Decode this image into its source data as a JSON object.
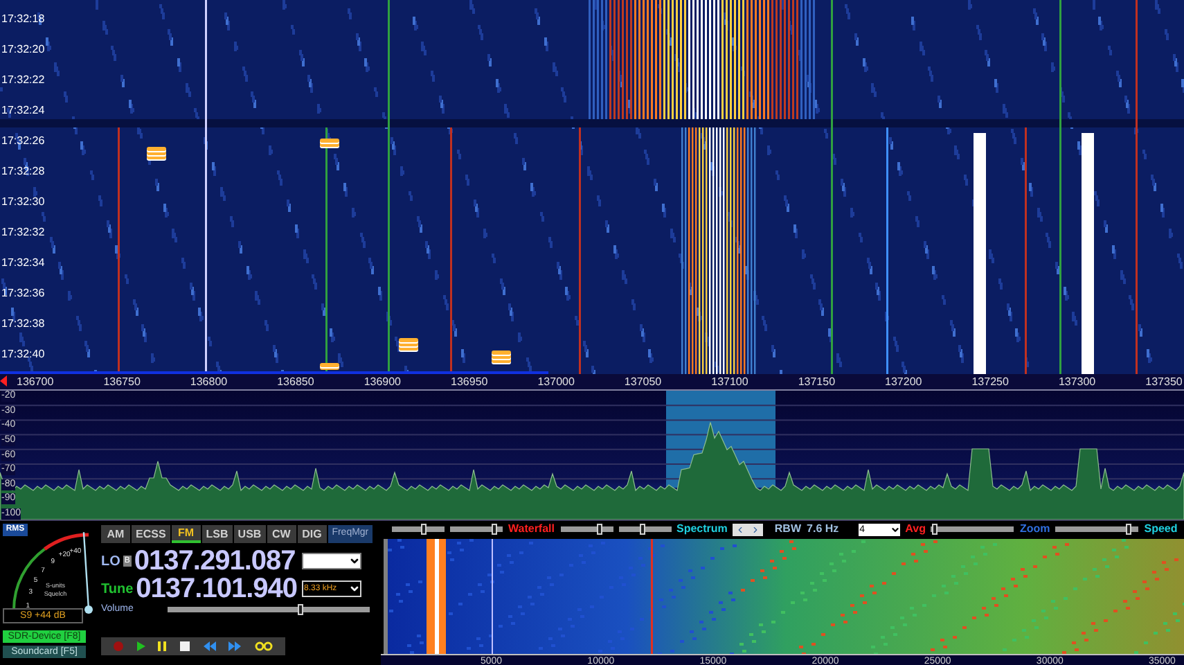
{
  "waterfall": {
    "time_labels": [
      "17:32:18",
      "17:32:20",
      "17:32:22",
      "17:32:24",
      "17:32:26",
      "17:32:28",
      "17:32:30",
      "17:32:32",
      "17:32:34",
      "17:32:36",
      "17:32:38",
      "17:32:40"
    ]
  },
  "frequency_axis": {
    "labels": [
      "136700",
      "136750",
      "136800",
      "136850",
      "136900",
      "136950",
      "137000",
      "137050",
      "137100",
      "137150",
      "137200",
      "137250",
      "137300",
      "137350"
    ]
  },
  "spectrum": {
    "db_labels": [
      "-20",
      "-30",
      "-40",
      "-50",
      "-60",
      "-70",
      "-80",
      "-90",
      "-100"
    ]
  },
  "smeter": {
    "mode_badge": "RMS",
    "scale_labels": [
      "1",
      "3",
      "5",
      "7",
      "9",
      "+20",
      "+40"
    ],
    "units_label": "S-units",
    "squelch_label": "Squelch",
    "level": 0.96,
    "reading": "S9 +44 dB"
  },
  "device_buttons": [
    {
      "label": "SDR-Device [F8]",
      "selected": true
    },
    {
      "label": "Soundcard [F5]",
      "selected": false
    }
  ],
  "modes": [
    {
      "label": "AM",
      "selected": false
    },
    {
      "label": "ECSS",
      "selected": false
    },
    {
      "label": "FM",
      "selected": true
    },
    {
      "label": "LSB",
      "selected": false
    },
    {
      "label": "USB",
      "selected": false
    },
    {
      "label": "CW",
      "selected": false
    },
    {
      "label": "DIG",
      "selected": false
    }
  ],
  "freq_manager_button": "FreqMgr",
  "lo": {
    "label": "LO",
    "badge": "B",
    "frequency": "0137.291.087"
  },
  "tune": {
    "label": "Tune",
    "frequency": "0137.101.940",
    "step": "8.33 kHz"
  },
  "volume": {
    "label": "Volume",
    "level": 0.66
  },
  "audio_controls": {
    "sliders_waterfall": [
      {
        "level": 0.6
      },
      {
        "level": 0.85
      }
    ],
    "waterfall_label": "Waterfall",
    "sliders_spectrum": [
      {
        "level": 0.75
      },
      {
        "level": 0.45
      }
    ],
    "spectrum_label": "Spectrum",
    "rbw_label": "RBW",
    "rbw_value": "7.6 Hz",
    "avg_value": "4",
    "avg_label": "Avg",
    "zoom_slider": {
      "level": 0.05
    },
    "zoom_label": "Zoom",
    "speed_slider": {
      "level": 0.88
    },
    "speed_label": "Speed"
  },
  "audio_axis": {
    "labels": [
      "5000",
      "10000",
      "15000",
      "20000",
      "25000",
      "30000",
      "35000"
    ]
  }
}
